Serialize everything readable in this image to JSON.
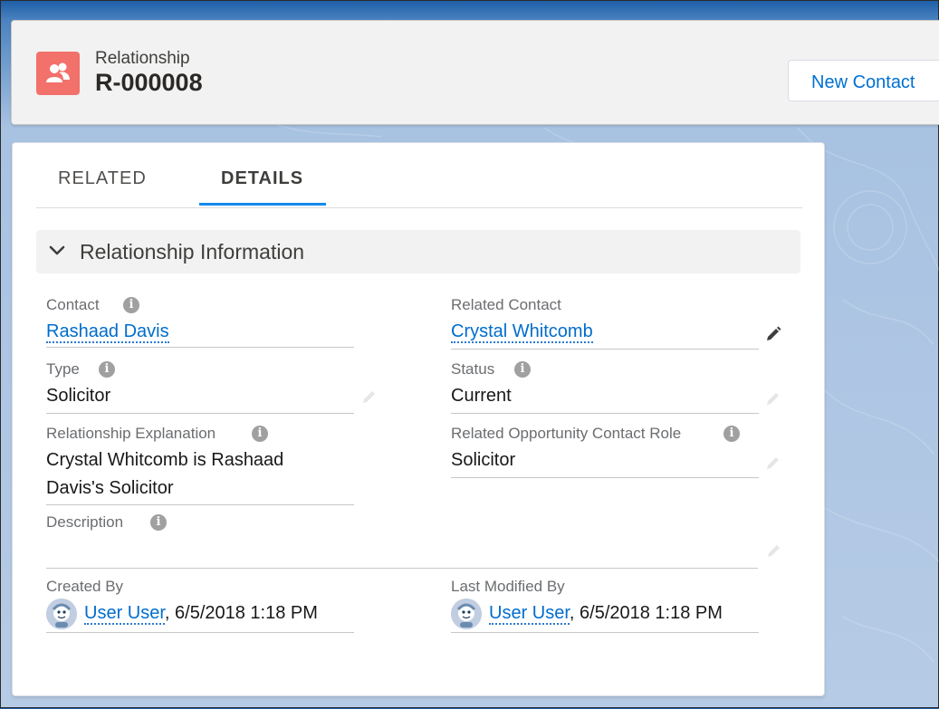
{
  "header": {
    "object_label": "Relationship",
    "record_name": "R-000008",
    "icon": "relationship-icon",
    "icon_color": "#f2716b",
    "new_contact_label": "New Contact"
  },
  "tabs": [
    {
      "label": "RELATED",
      "active": false
    },
    {
      "label": "DETAILS",
      "active": true
    }
  ],
  "section": {
    "title": "Relationship Information",
    "expanded": true
  },
  "fields": {
    "contact": {
      "label": "Contact",
      "value": "Rashaad Davis"
    },
    "related_contact": {
      "label": "Related Contact",
      "value": "Crystal Whitcomb"
    },
    "type": {
      "label": "Type",
      "value": "Solicitor"
    },
    "status": {
      "label": "Status",
      "value": "Current"
    },
    "explanation": {
      "label": "Relationship Explanation",
      "value_line1": "Crystal Whitcomb is Rashaad",
      "value_line2": "Davis's Solicitor"
    },
    "related_role": {
      "label": "Related Opportunity Contact Role",
      "value": "Solicitor"
    },
    "description": {
      "label": "Description",
      "value": ""
    },
    "created_by": {
      "label": "Created By",
      "user": "User User",
      "date": ", 6/5/2018 1:18 PM"
    },
    "last_modified_by": {
      "label": "Last Modified By",
      "user": "User User",
      "date": ", 6/5/2018 1:18 PM"
    }
  },
  "colors": {
    "link": "#006dcc",
    "tab_active": "#1589ee",
    "icon_bg": "#f2716b"
  }
}
